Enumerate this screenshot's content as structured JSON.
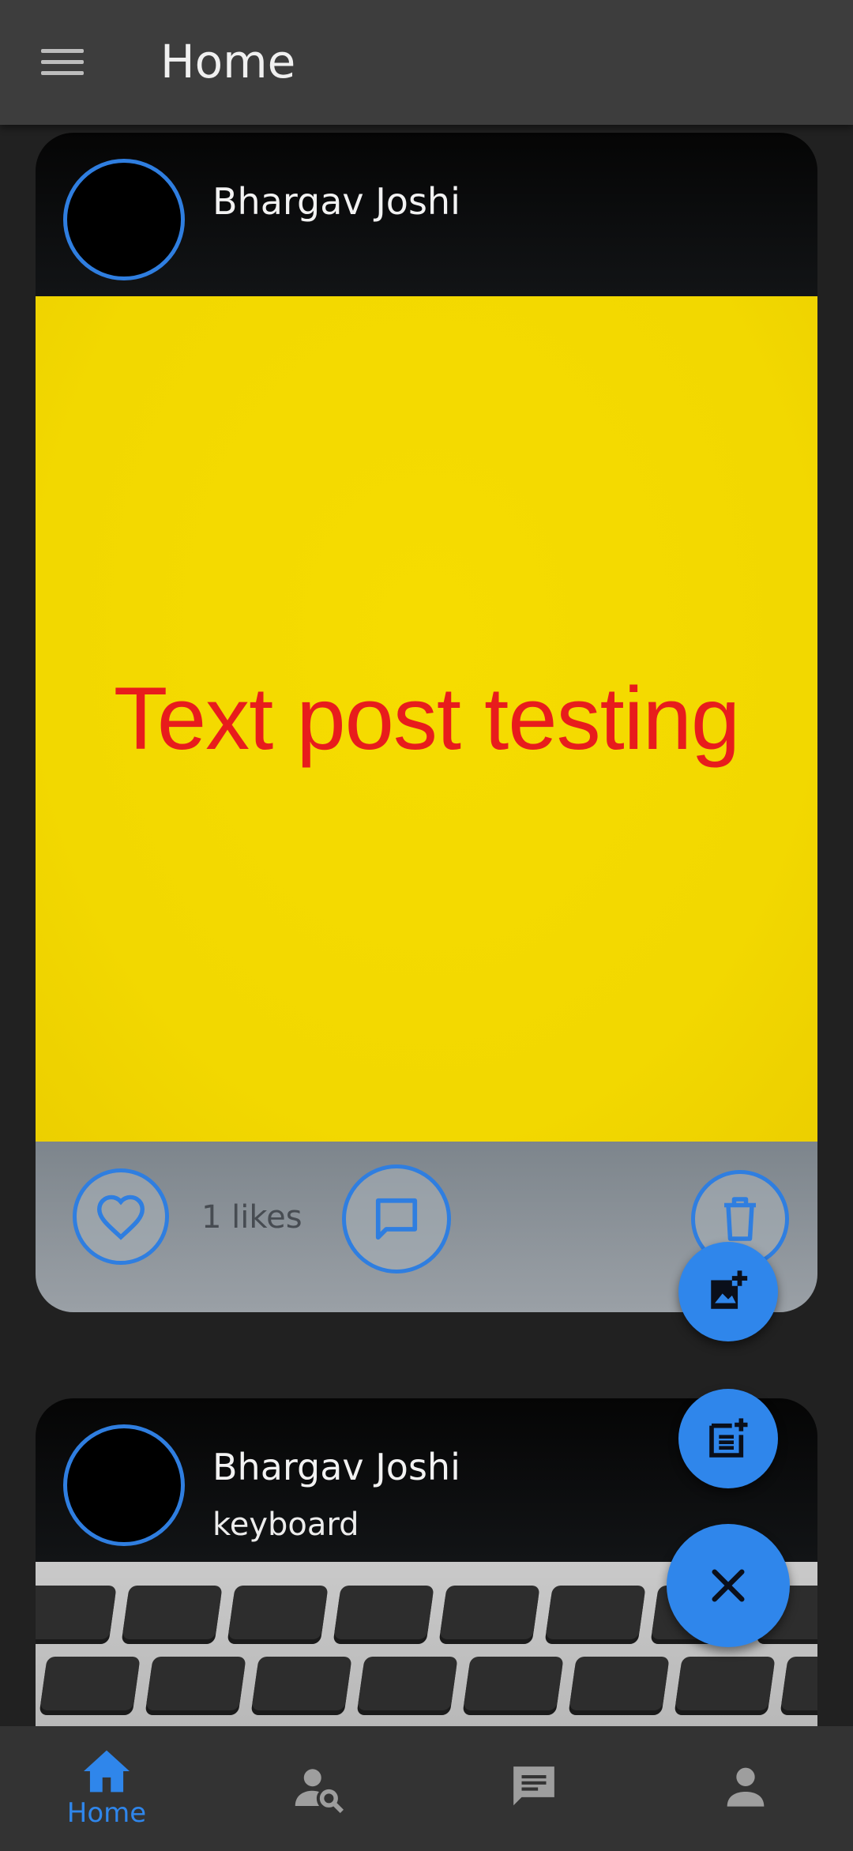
{
  "appbar": {
    "title": "Home",
    "menu_icon": "menu-icon"
  },
  "posts": [
    {
      "author": "Bhargav Joshi",
      "caption": "",
      "image_text": "Text post testing",
      "likes_label": "1 likes"
    },
    {
      "author": "Bhargav Joshi",
      "caption": "keyboard"
    }
  ],
  "bottom_nav": {
    "items": [
      {
        "label": "Home",
        "icon": "home-icon",
        "active": true
      },
      {
        "label": "",
        "icon": "user-search-icon",
        "active": false
      },
      {
        "label": "",
        "icon": "chat-icon",
        "active": false
      },
      {
        "label": "",
        "icon": "person-icon",
        "active": false
      }
    ]
  },
  "colors": {
    "accent": "#2f86eb",
    "appbar": "#3d3d3d",
    "background": "#212121",
    "post_text": "#e81c1c",
    "post_bg": "#f2d800"
  }
}
